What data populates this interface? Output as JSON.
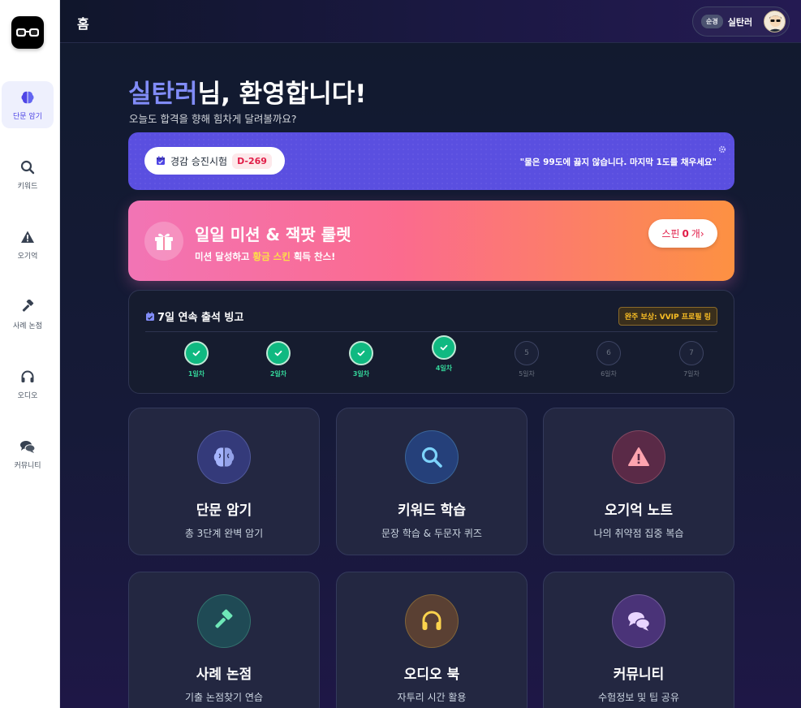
{
  "sidebar": {
    "items": [
      {
        "label": "단문 암기",
        "icon": "brain-icon",
        "active": true
      },
      {
        "label": "키워드",
        "icon": "search-icon"
      },
      {
        "label": "오기억",
        "icon": "warning-icon"
      },
      {
        "label": "사례 논점",
        "icon": "gavel-icon"
      },
      {
        "label": "오디오",
        "icon": "headphones-icon"
      },
      {
        "label": "커뮤니티",
        "icon": "chat-icon"
      }
    ]
  },
  "header": {
    "title": "홈",
    "user": {
      "rank": "순경",
      "name": "실탄러"
    }
  },
  "welcome": {
    "name": "실탄러",
    "suffix": "님, 환영합니다!",
    "subtitle": "오늘도 합격을 향해 힘차게 달려볼까요?"
  },
  "exam": {
    "name": "경감 승진시험",
    "dday": "D-269",
    "quote": "\"물은 99도에 끓지 않습니다. 마지막 1도를 채우세요\""
  },
  "mission": {
    "title": "일일 미션 & 잭팟 룰렛",
    "sub_before": "미션 달성하고 ",
    "sub_gold": "황금 스킨",
    "sub_after": " 획득 찬스!",
    "spin_label": "스핀",
    "spin_count": "0",
    "spin_unit": "개",
    "spin_arrow": "›"
  },
  "bingo": {
    "title": "7일 연속 출석 빙고",
    "reward": "완주 보상: VVIP 프로필 링",
    "days": [
      {
        "num": "1",
        "label": "1일차",
        "done": true
      },
      {
        "num": "2",
        "label": "2일차",
        "done": true
      },
      {
        "num": "3",
        "label": "3일차",
        "done": true
      },
      {
        "num": "4",
        "label": "4일차",
        "done": true,
        "today": true
      },
      {
        "num": "5",
        "label": "5일차",
        "done": false
      },
      {
        "num": "6",
        "label": "6일차",
        "done": false
      },
      {
        "num": "7",
        "label": "7일차",
        "done": false
      }
    ]
  },
  "cards": [
    {
      "title": "단문 암기",
      "desc": "총 3단계 완벽 암기",
      "icon": "brain-icon",
      "color": "#a5b4fc",
      "bg": "#343a7a"
    },
    {
      "title": "키워드 학습",
      "desc": "문장 학습 & 두문자 퀴즈",
      "icon": "search-icon",
      "color": "#7dd3fc",
      "bg": "#25407a"
    },
    {
      "title": "오기억 노트",
      "desc": "나의 취약점 집중 복습",
      "icon": "warning-icon",
      "color": "#fda4af",
      "bg": "#5a2a47"
    },
    {
      "title": "사례 논점",
      "desc": "기출 논점찾기 연습",
      "icon": "gavel-icon",
      "color": "#6ee7b7",
      "bg": "#1f4a55"
    },
    {
      "title": "오디오 북",
      "desc": "자투리 시간 활용",
      "icon": "headphones-icon",
      "color": "#fcd34d",
      "bg": "#5a4033"
    },
    {
      "title": "커뮤니티",
      "desc": "수험정보 및 팁 공유",
      "icon": "chat-icon",
      "color": "#e9d5ff",
      "bg": "#4a3378"
    }
  ]
}
